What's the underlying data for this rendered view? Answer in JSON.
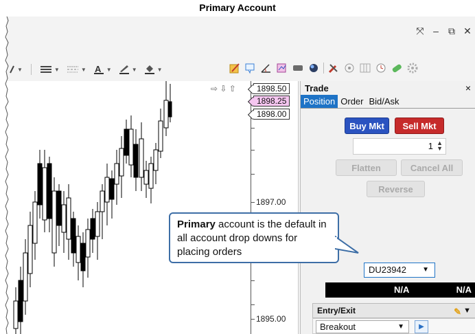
{
  "page": {
    "title": "Primary Account"
  },
  "window_controls": [
    {
      "name": "fullscreen-icon",
      "glyph": "⤧"
    },
    {
      "name": "minimize-icon",
      "glyph": "–"
    },
    {
      "name": "restore-icon",
      "glyph": "⧉"
    },
    {
      "name": "close-icon",
      "glyph": "✕"
    }
  ],
  "chart": {
    "prices": {
      "tag_top": "1898.50",
      "tag_mid": "1898.25",
      "tag_low": "1898.00",
      "label_1897": "1897.00",
      "label_1895": "1895.00"
    },
    "arrows": "⇨ ⇩ ⇧"
  },
  "trade": {
    "title": "Trade",
    "close": "×",
    "tabs": [
      "Position",
      "Order",
      "Bid/Ask"
    ],
    "buy_label": "Buy Mkt",
    "sell_label": "Sell Mkt",
    "quantity": "1",
    "flatten_label": "Flatten",
    "cancel_all_label": "Cancel All",
    "reverse_label": "Reverse",
    "account": "DU23942",
    "na_1": "N/A",
    "na_2": "N/A",
    "entry_exit": {
      "title": "Entry/Exit",
      "strategy": "Breakout"
    }
  },
  "callout": {
    "bold": "Primary",
    "text": " account is the default in all account drop downs for placing orders"
  },
  "colors": {
    "accent_blue": "#1e73c6",
    "buy_blue": "#2b53c0",
    "sell_red": "#c62b2b",
    "pink_tag": "#f5c6f0",
    "callout_border": "#3d6ea6"
  }
}
